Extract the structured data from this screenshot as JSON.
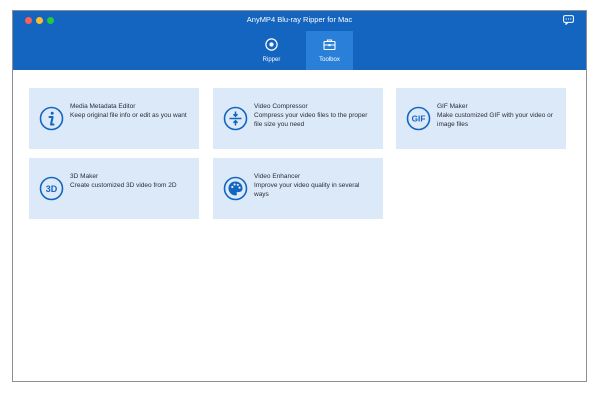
{
  "window": {
    "title": "AnyMP4 Blu-ray Ripper for Mac"
  },
  "colors": {
    "header": "#1465c0",
    "active_tab": "#2a80d8",
    "card_background": "#dce9f9",
    "icon_stroke": "#1465c0"
  },
  "nav": {
    "tabs": [
      {
        "label": "Ripper",
        "icon": "disc-icon",
        "active": false
      },
      {
        "label": "Toolbox",
        "icon": "toolbox-icon",
        "active": true
      }
    ]
  },
  "toolbox": {
    "items": [
      {
        "title": "Media Metadata Editor",
        "description": "Keep original file info or edit as you want",
        "icon": "info-icon"
      },
      {
        "title": "Video Compressor",
        "description": "Compress your video files to the proper file size you need",
        "icon": "compress-icon"
      },
      {
        "title": "GIF Maker",
        "description": "Make customized GIF with your video or image files",
        "icon": "gif-icon",
        "icon_text": "GIF"
      },
      {
        "title": "3D Maker",
        "description": "Create customized 3D video from 2D",
        "icon": "3d-icon",
        "icon_text": "3D"
      },
      {
        "title": "Video Enhancer",
        "description": "Improve your video quality in several ways",
        "icon": "palette-icon"
      }
    ]
  }
}
